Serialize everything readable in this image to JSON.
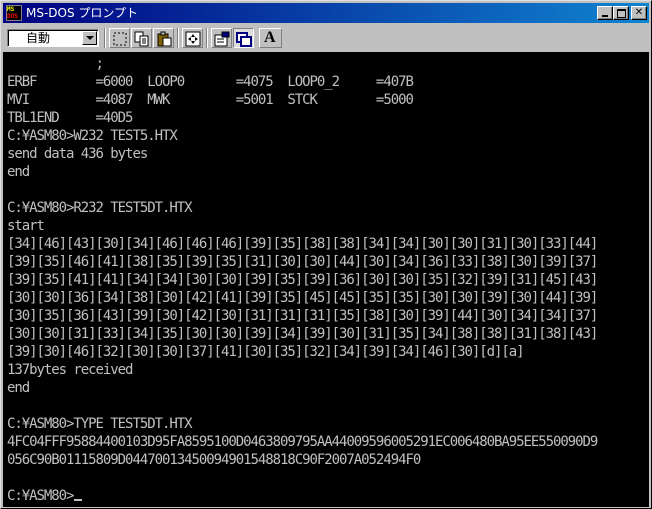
{
  "window": {
    "title": "MS-DOS プロンプト",
    "icon_name": "ms-dos-icon",
    "icon_text": {
      "top": "MS",
      "bottom": "DOS"
    }
  },
  "toolbar": {
    "font_size_value": "自動",
    "tools": [
      {
        "name": "mark-icon",
        "pressed": false
      },
      {
        "name": "copy-icon",
        "pressed": false
      },
      {
        "name": "paste-icon",
        "pressed": false
      },
      {
        "name": "fullscreen-icon",
        "pressed": false
      },
      {
        "name": "properties-icon",
        "pressed": false
      },
      {
        "name": "background-icon",
        "pressed": true
      },
      {
        "name": "font-icon",
        "pressed": false
      }
    ],
    "font_button_label": "A"
  },
  "console": {
    "lines": [
      "            ;",
      "ERBF        =6000  LOOP0       =4075  LOOP0_2     =407B",
      "MVI         =4087  MWK         =5001  STCK        =5000",
      "TBL1END     =40D5",
      "C:¥ASM80>W232 TEST5.HTX",
      "send data 436 bytes",
      "end",
      "",
      "C:¥ASM80>R232 TEST5DT.HTX",
      "start",
      "[34][46][43][30][34][46][46][46][39][35][38][38][34][34][30][30][31][30][33][44]",
      "[39][35][46][41][38][35][39][35][31][30][30][44][30][34][36][33][38][30][39][37]",
      "[39][35][41][41][34][34][30][30][39][35][39][36][30][30][35][32][39][31][45][43]",
      "[30][30][36][34][38][30][42][41][39][35][45][45][35][35][30][30][39][30][44][39]",
      "[30][35][36][43][39][30][42][30][31][31][31][35][38][30][39][44][30][34][34][37]",
      "[30][30][31][33][34][35][30][30][39][34][39][30][31][35][34][38][38][31][38][43]",
      "[39][30][46][32][30][30][37][41][30][35][32][34][39][34][46][30][d][a]",
      "137bytes received",
      "end",
      "",
      "C:¥ASM80>TYPE TEST5DT.HTX",
      "4FC04FFF95884400103D95FA8595100D0463809795AA44009596005291EC006480BA95EE550090D9",
      "056C90B01115809D04470013450094901548818C90F2007A052494F0",
      "",
      "C:¥ASM80>"
    ],
    "cursor_visible": true,
    "fg_color": "#c0c0c0",
    "bg_color": "#000000"
  },
  "colors": {
    "titlebar_start": "#000080",
    "titlebar_end": "#1084d0",
    "chrome": "#c0c0c0"
  }
}
